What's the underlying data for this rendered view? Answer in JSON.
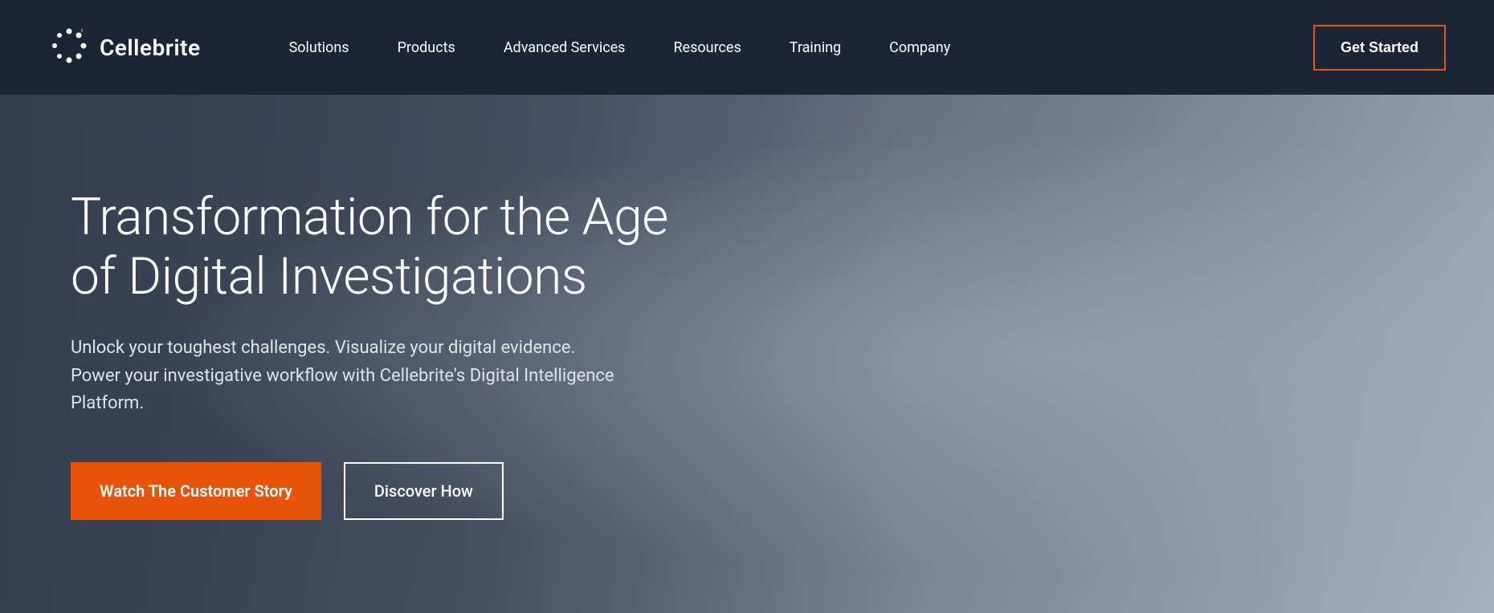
{
  "brand": {
    "name": "Cellebrite",
    "logo_alt": "Cellebrite logo"
  },
  "navbar": {
    "links": [
      {
        "label": "Solutions",
        "id": "solutions"
      },
      {
        "label": "Products",
        "id": "products"
      },
      {
        "label": "Advanced Services",
        "id": "advanced-services"
      },
      {
        "label": "Resources",
        "id": "resources"
      },
      {
        "label": "Training",
        "id": "training"
      },
      {
        "label": "Company",
        "id": "company"
      }
    ],
    "cta_label": "Get Started"
  },
  "hero": {
    "title": "Transformation for the Age of Digital Investigations",
    "subtitle": "Unlock your toughest challenges. Visualize your digital evidence. Power your investigative workflow with Cellebrite's Digital Intelligence Platform.",
    "btn_primary": "Watch The Customer Story",
    "btn_secondary": "Discover How"
  },
  "colors": {
    "accent_orange": "#e8530a",
    "nav_bg": "#1a2535",
    "hero_bg_start": "#3d4a5c",
    "hero_bg_end": "#b0b8c1"
  }
}
